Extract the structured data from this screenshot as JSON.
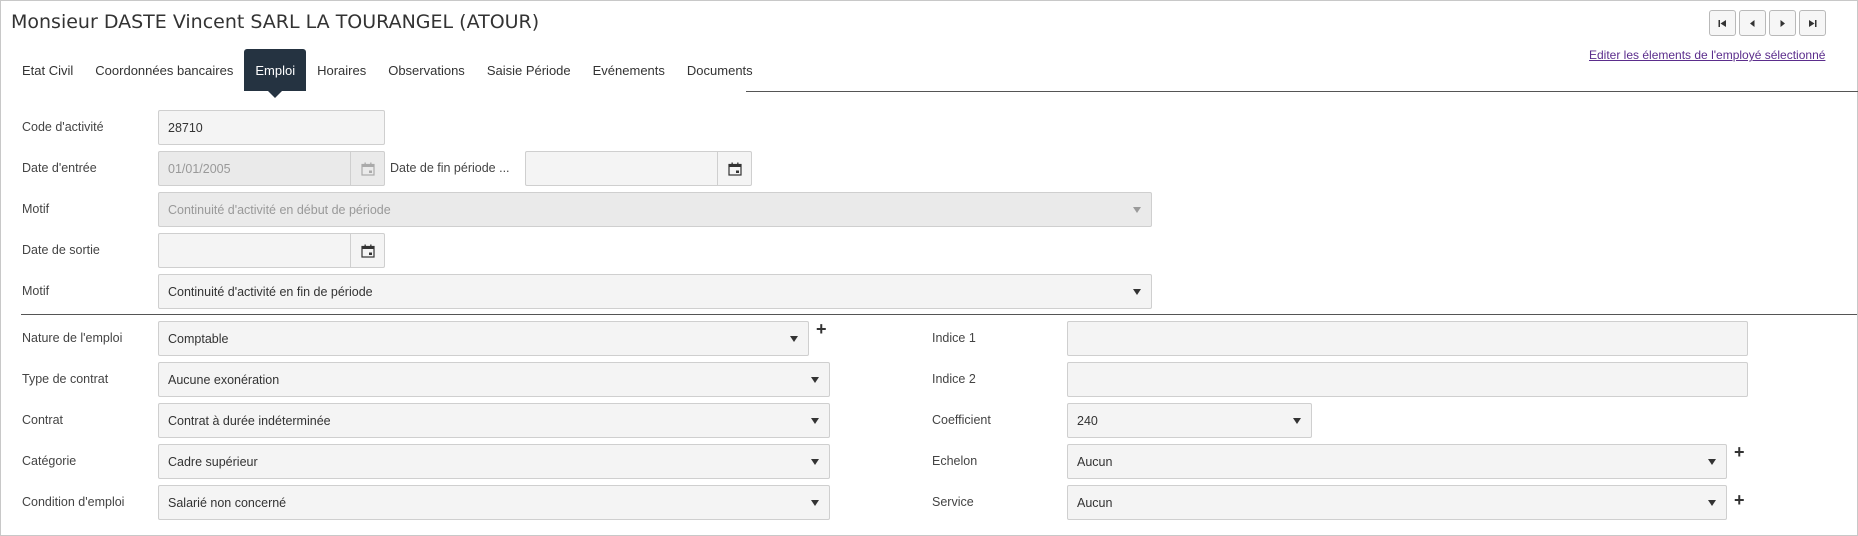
{
  "header": {
    "title": "Monsieur DASTE Vincent SARL LA TOURANGEL (ATOUR)",
    "edit_link": "Editer les élements de l'employé sélectionné"
  },
  "nav_buttons": [
    "first-icon",
    "previous-icon",
    "next-icon",
    "last-icon"
  ],
  "tabs": [
    {
      "label": "Etat Civil"
    },
    {
      "label": "Coordonnées bancaires"
    },
    {
      "label": "Emploi",
      "active": true
    },
    {
      "label": "Horaires"
    },
    {
      "label": "Observations"
    },
    {
      "label": "Saisie Période"
    },
    {
      "label": "Evénements"
    },
    {
      "label": "Documents"
    }
  ],
  "top_form": {
    "code_activite": {
      "label": "Code d'activité",
      "value": "28710"
    },
    "date_entree": {
      "label": "Date d'entrée",
      "value": "01/01/2005"
    },
    "date_fin_periode": {
      "label": "Date de fin période ...",
      "value": ""
    },
    "motif_entree": {
      "label": "Motif",
      "value": "Continuité d'activité en début de période"
    },
    "date_sortie": {
      "label": "Date de sortie",
      "value": ""
    },
    "motif_sortie": {
      "label": "Motif",
      "value": "Continuité d'activité en fin de période"
    }
  },
  "left_form": {
    "nature_emploi": {
      "label": "Nature de l'emploi",
      "value": "Comptable"
    },
    "type_contrat": {
      "label": "Type de contrat",
      "value": "Aucune exonération"
    },
    "contrat": {
      "label": "Contrat",
      "value": "Contrat à durée indéterminée"
    },
    "categorie": {
      "label": "Catégorie",
      "value": "Cadre supérieur"
    },
    "condition_emploi": {
      "label": "Condition d'emploi",
      "value": "Salarié non concerné"
    }
  },
  "right_form": {
    "indice1": {
      "label": "Indice 1",
      "value": ""
    },
    "indice2": {
      "label": "Indice 2",
      "value": ""
    },
    "coefficient": {
      "label": "Coefficient",
      "value": "240"
    },
    "echelon": {
      "label": "Echelon",
      "value": "Aucun"
    },
    "service": {
      "label": "Service",
      "value": "Aucun"
    }
  },
  "plus_symbol": "+",
  "colors": {
    "active_tab": "#253341",
    "link": "#5b2d8c",
    "field_bg": "#f4f4f4"
  }
}
